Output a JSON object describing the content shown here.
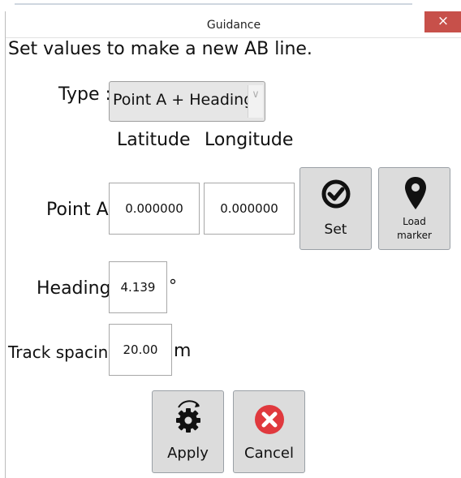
{
  "window": {
    "title": "Guidance",
    "close_glyph": "×"
  },
  "form": {
    "instruction": "Set values to make a new AB line.",
    "type_label": "Type :",
    "type_value": "Point A + Heading",
    "latitude_header": "Latitude",
    "longitude_header": "Longitude",
    "point_label": "Point A",
    "latitude_value": "0.000000",
    "longitude_value": "0.000000",
    "heading_label": "Heading",
    "heading_value": "4.139",
    "heading_unit": "°",
    "track_label": "Track spacing",
    "track_value": "20.00",
    "track_unit": "m"
  },
  "buttons": {
    "set": "Set",
    "load_marker_line1": "Load",
    "load_marker_line2": "marker",
    "apply": "Apply",
    "cancel": "Cancel"
  },
  "icons": {
    "set": "check-circle-icon",
    "load_marker": "map-pin-icon",
    "apply": "gear-icon",
    "cancel": "x-circle-icon",
    "dropdown": "chevron-down-icon"
  },
  "colors": {
    "close_button": "#c7504a",
    "cancel_icon": "#e0393e",
    "button_bg": "#dcdcdc"
  }
}
